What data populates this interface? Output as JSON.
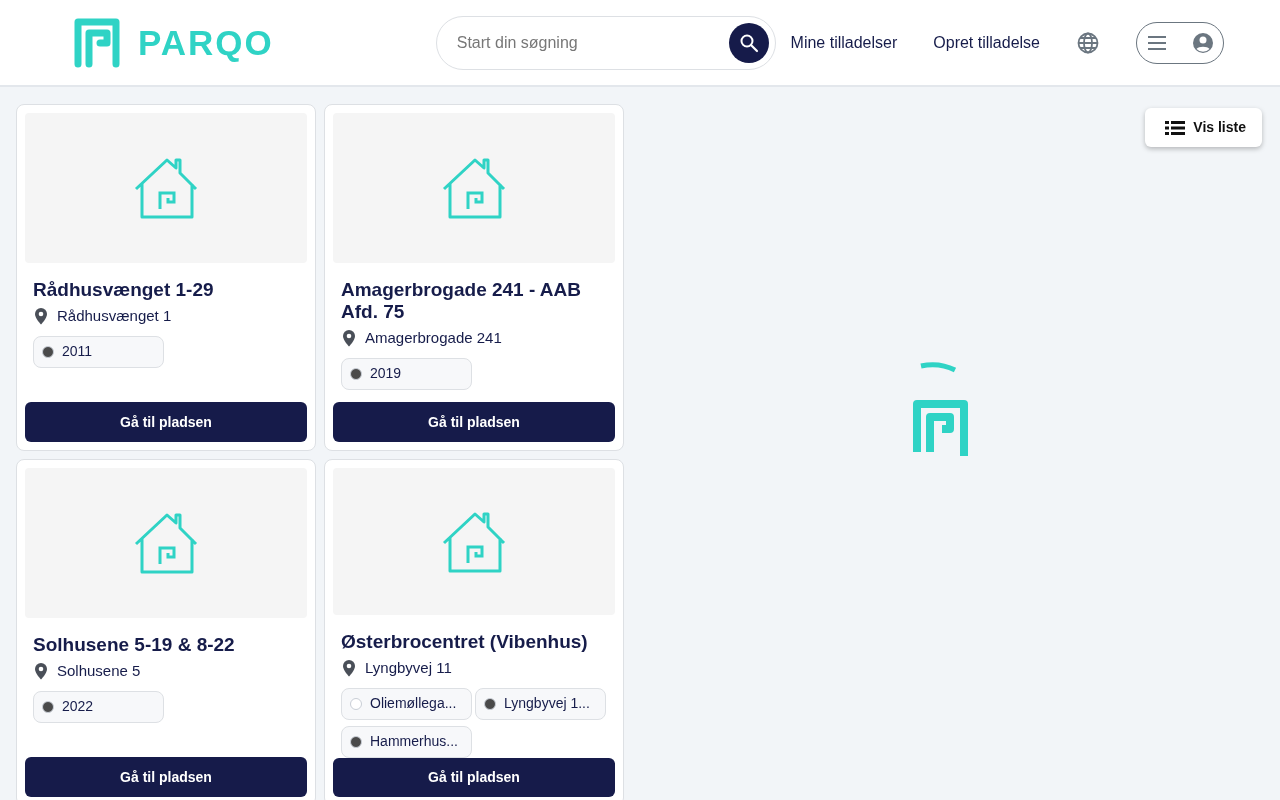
{
  "header": {
    "logo_text": "PARQO",
    "search": {
      "placeholder": "Start din søgning"
    },
    "nav_links": [
      "Mine tilladelser",
      "Opret tilladelse"
    ]
  },
  "listings": [
    {
      "title": "Rådhusvænget 1-29",
      "address": "Rådhusvænget 1",
      "tags": [
        {
          "label": "2011",
          "color": "#4a4a4a"
        }
      ],
      "button": "Gå til pladsen"
    },
    {
      "title": "Amagerbrogade 241 - AAB Afd. 75",
      "address": "Amagerbrogade 241",
      "tags": [
        {
          "label": "2019",
          "color": "#4a4a4a"
        }
      ],
      "button": "Gå til pladsen"
    },
    {
      "title": "Solhusene 5-19 & 8-22",
      "address": "Solhusene 5",
      "tags": [
        {
          "label": "2022",
          "color": "#4a4a4a"
        }
      ],
      "button": "Gå til pladsen"
    },
    {
      "title": "Østerbrocentret (Vibenhus)",
      "address": "Lyngbyvej 11",
      "tags": [
        {
          "label": "Oliemøllega...",
          "color": "#ffffff"
        },
        {
          "label": "Lyngbyvej 1...",
          "color": "#4a4a4a"
        },
        {
          "label": "Hammerhus...",
          "color": "#4a4a4a"
        }
      ],
      "button": "Gå til pladsen"
    }
  ],
  "map": {
    "list_button": "Vis liste"
  }
}
